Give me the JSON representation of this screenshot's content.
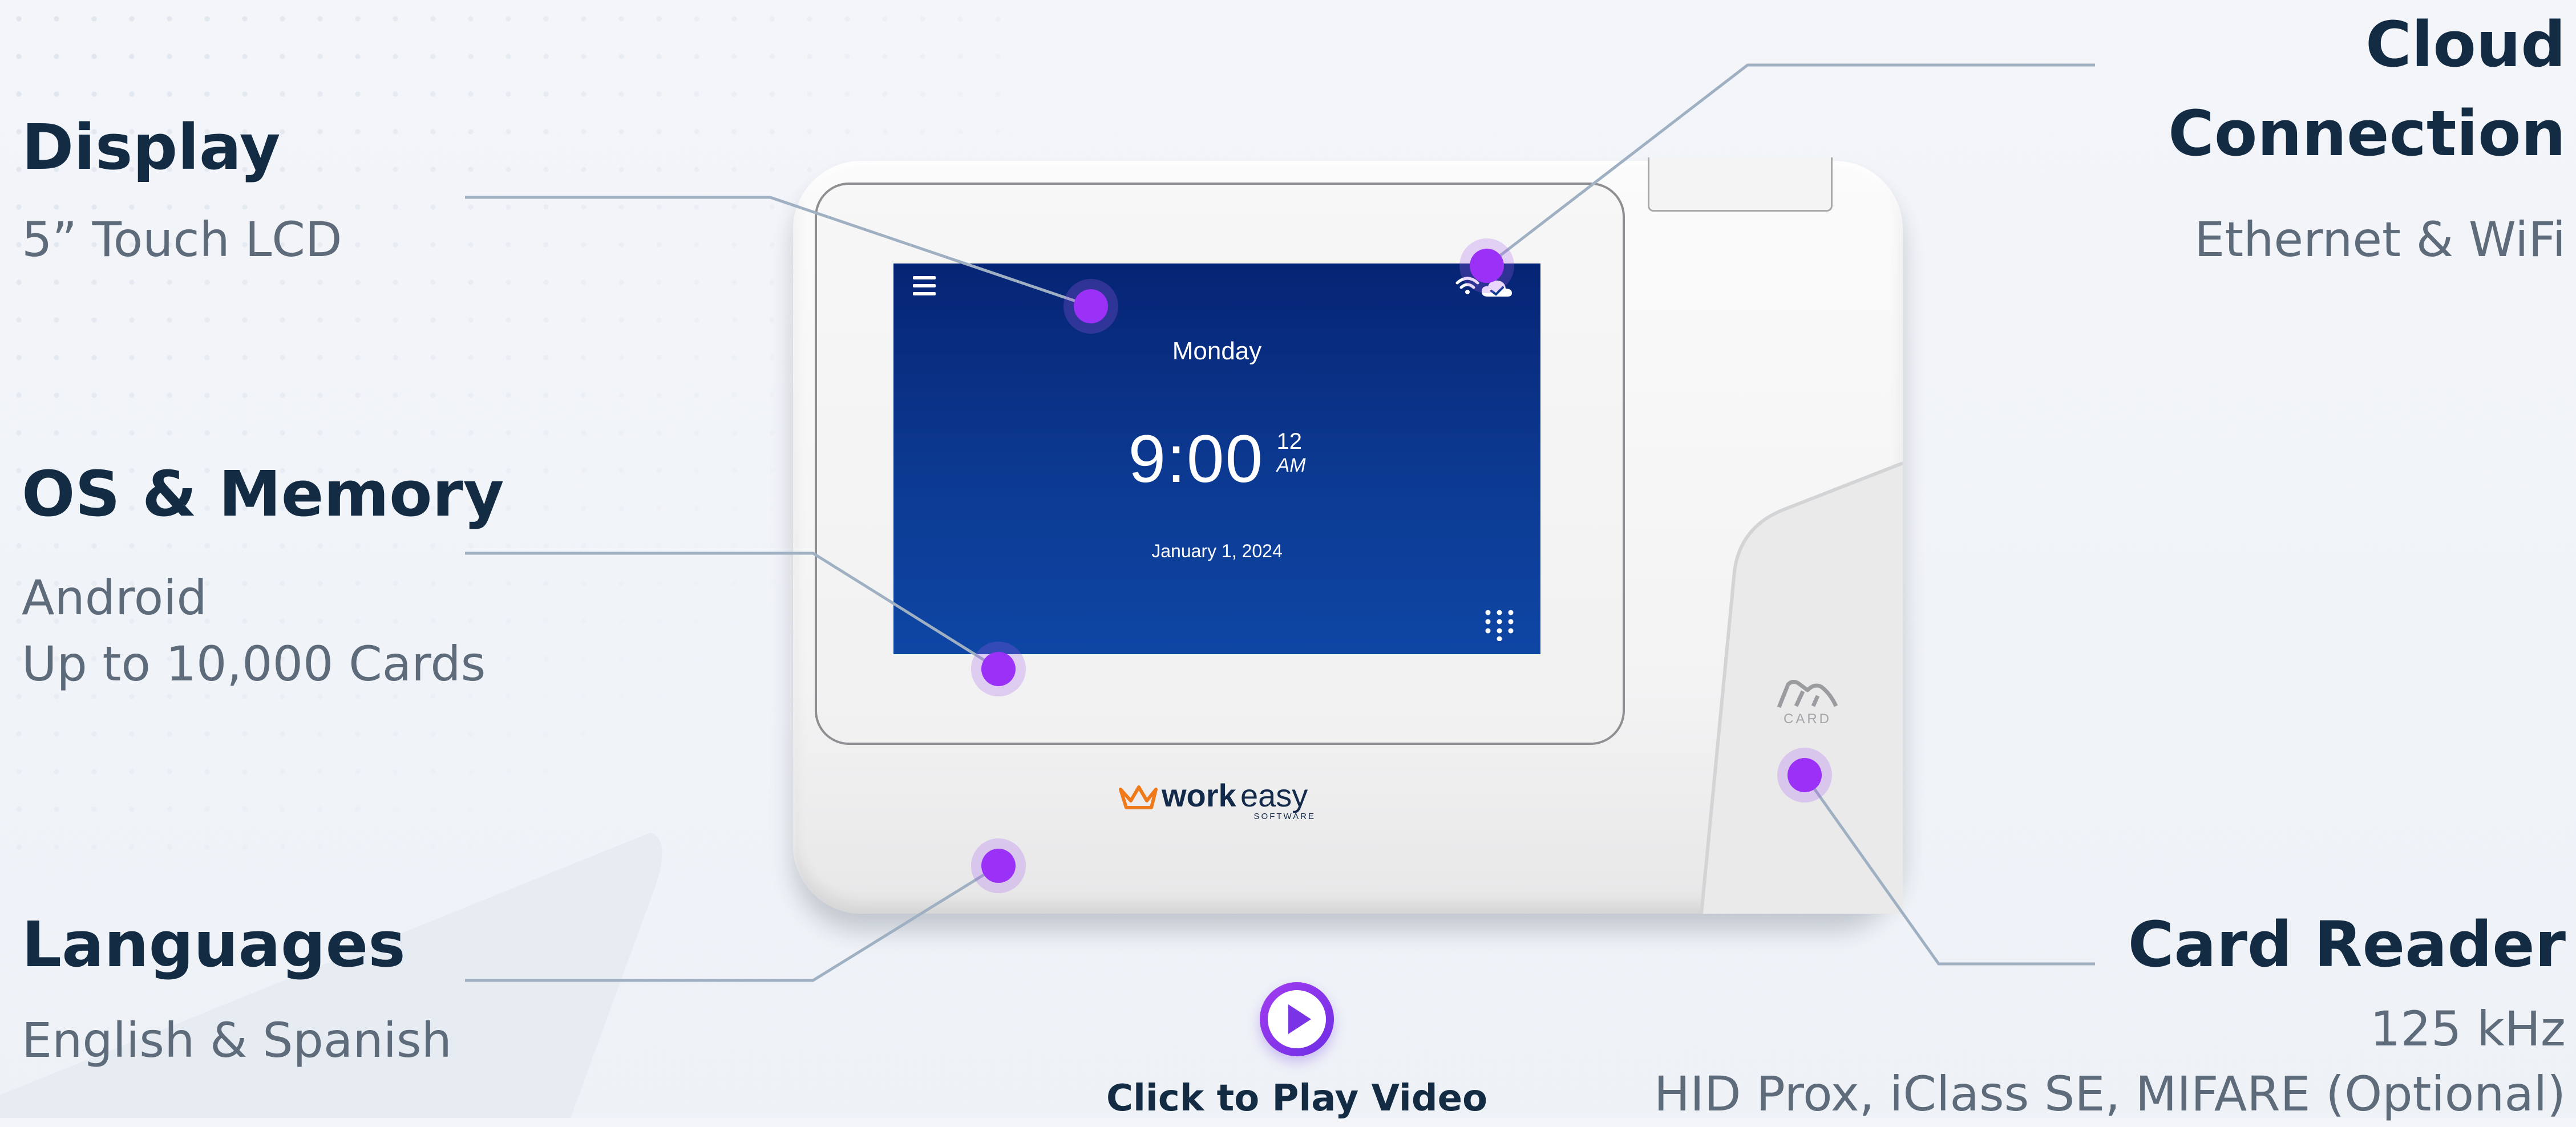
{
  "features": {
    "display": {
      "title": "Display",
      "lines": [
        "5” Touch LCD"
      ]
    },
    "os_memory": {
      "title": "OS & Memory",
      "lines": [
        "Android",
        "Up to 10,000 Cards"
      ]
    },
    "languages": {
      "title": "Languages",
      "lines": [
        "English & Spanish"
      ]
    },
    "cloud": {
      "title_lines": [
        "Cloud",
        "Connection"
      ],
      "lines": [
        "Ethernet & WiFi"
      ]
    },
    "card_reader": {
      "title": "Card Reader",
      "lines": [
        "125 kHz",
        "HID Prox, iClass SE, MIFARE (Optional)"
      ]
    }
  },
  "device_screen": {
    "day": "Monday",
    "time": "9:00",
    "seconds": "12",
    "ampm": "AM",
    "date": "January 1, 2024",
    "icons": [
      "menu-icon",
      "wifi-icon",
      "cloud-check-icon",
      "keypad-icon"
    ]
  },
  "brand": {
    "name_part1": "work",
    "name_part2": "easy",
    "tagline": "SOFTWARE"
  },
  "card_label": "CARD",
  "video": {
    "label": "Click to Play Video"
  },
  "colors": {
    "accent": "#9b30f6",
    "heading": "#132c44",
    "body_text": "#5e6b7a",
    "screen_top": "#062474",
    "screen_bottom": "#0e46a5",
    "brand_orange": "#f07a1a",
    "brand_navy": "#142a4a"
  }
}
